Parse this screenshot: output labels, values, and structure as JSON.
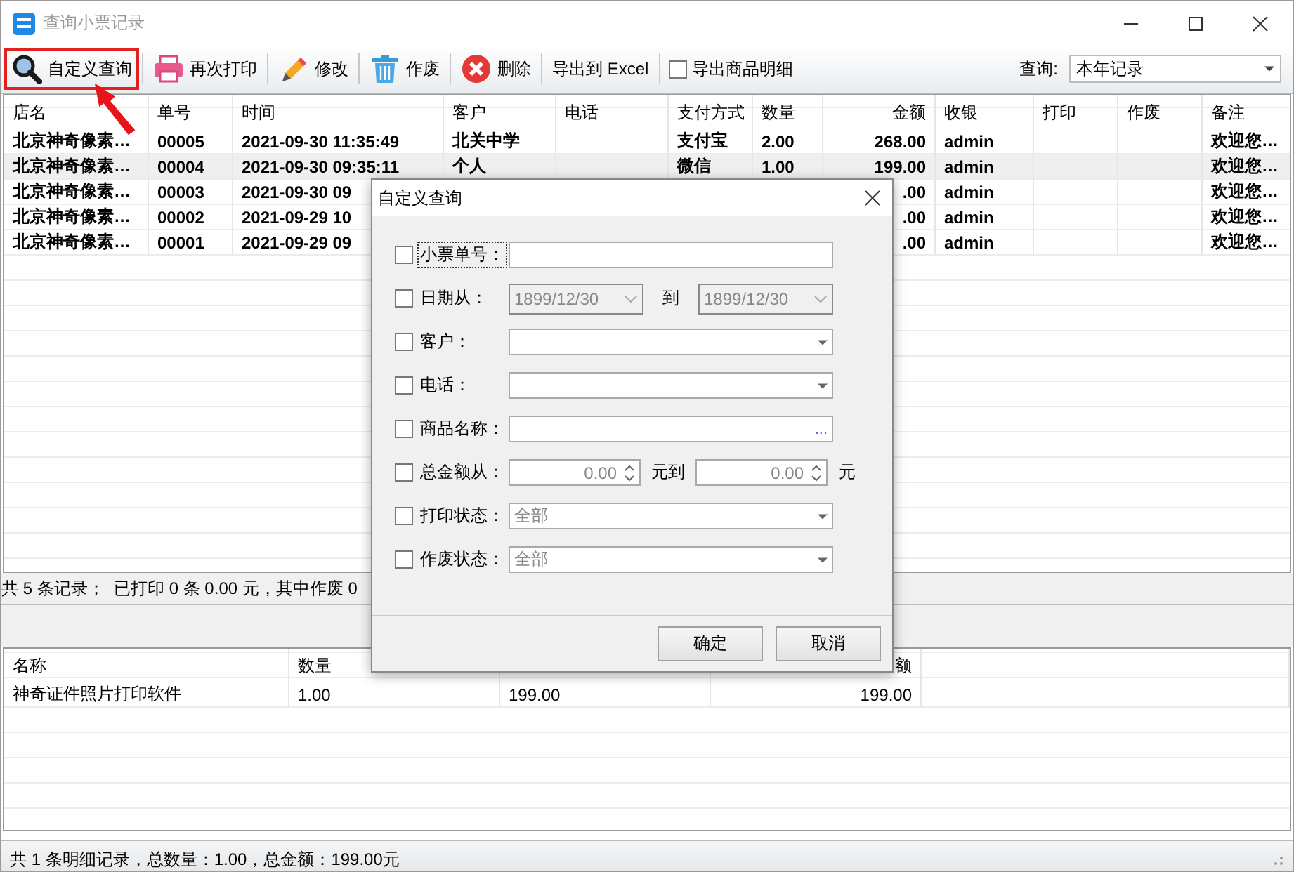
{
  "window": {
    "title": "查询小票记录"
  },
  "toolbar": {
    "buttons": [
      {
        "kind": "search",
        "label": "自定义查询",
        "highlighted": true
      },
      {
        "kind": "printer",
        "label": "再次打印",
        "highlighted": false
      },
      {
        "kind": "pencil",
        "label": "修改",
        "highlighted": false
      },
      {
        "kind": "trash",
        "label": "作废",
        "highlighted": false
      },
      {
        "kind": "delete",
        "label": "删除",
        "highlighted": false
      },
      {
        "kind": "text",
        "label": "导出到 Excel",
        "highlighted": false
      }
    ],
    "export_details": {
      "label": "导出商品明细",
      "checked": false
    },
    "query": {
      "label": "查询:",
      "value": "本年记录"
    }
  },
  "orders": {
    "columns": [
      "店名",
      "单号",
      "时间",
      "客户",
      "电话",
      "支付方式",
      "数量",
      "金额",
      "收银",
      "打印",
      "作废",
      "备注"
    ],
    "rows": [
      {
        "selected": false,
        "cells": [
          "北京神奇像素…",
          "00005",
          "2021-09-30 11:35:49",
          "北关中学",
          "",
          "支付宝",
          "2.00",
          "268.00",
          "admin",
          "",
          "",
          "欢迎您…"
        ]
      },
      {
        "selected": true,
        "cells": [
          "北京神奇像素…",
          "00004",
          "2021-09-30 09:35:11",
          "个人",
          "",
          "微信",
          "1.00",
          "199.00",
          "admin",
          "",
          "",
          "欢迎您…"
        ]
      },
      {
        "selected": false,
        "cells": [
          "北京神奇像素…",
          "00003",
          "2021-09-30 09",
          "",
          "",
          "",
          "",
          ".00",
          "admin",
          "",
          "",
          "欢迎您…"
        ]
      },
      {
        "selected": false,
        "cells": [
          "北京神奇像素…",
          "00002",
          "2021-09-29 10",
          "",
          "",
          "",
          "",
          ".00",
          "admin",
          "",
          "",
          "欢迎您…"
        ]
      },
      {
        "selected": false,
        "cells": [
          "北京神奇像素…",
          "00001",
          "2021-09-29 09",
          "",
          "",
          "",
          "",
          ".00",
          "admin",
          "",
          "",
          "欢迎您…"
        ]
      }
    ]
  },
  "orders_status": "共 5 条记录；  已打印 0 条 0.00 元，其中作废 0",
  "details": {
    "columns": [
      "名称",
      "数量",
      "",
      "额"
    ],
    "rows": [
      {
        "cells": [
          "神奇证件照片打印软件",
          "1.00",
          "199.00",
          "199.00"
        ]
      }
    ]
  },
  "status_bar": "共 1 条明细记录，总数量：1.00，总金额：199.00元",
  "dialog": {
    "title": "自定义查询",
    "filters": [
      {
        "kind": "text",
        "label": "小票单号：",
        "checked": false,
        "focused": true
      },
      {
        "kind": "date-range",
        "label": "日期从：",
        "checked": false,
        "focused": false,
        "from": "1899/12/30",
        "joiner": "到",
        "to": "1899/12/30"
      },
      {
        "kind": "combo",
        "label": "客户：",
        "checked": false,
        "focused": false
      },
      {
        "kind": "combo",
        "label": "电话：",
        "checked": false,
        "focused": false
      },
      {
        "kind": "ellipsis",
        "label": "商品名称：",
        "checked": false,
        "focused": false,
        "button": "..."
      },
      {
        "kind": "number-range",
        "label": "总金额从：",
        "checked": false,
        "focused": false,
        "from": "0.00",
        "joiner": "元到",
        "to": "0.00",
        "unit": "元"
      },
      {
        "kind": "combo",
        "label": "打印状态：",
        "checked": false,
        "focused": false,
        "value": "全部"
      },
      {
        "kind": "combo",
        "label": "作废状态：",
        "checked": false,
        "focused": false,
        "value": "全部"
      }
    ],
    "buttons": [
      "确定",
      "取消"
    ]
  }
}
